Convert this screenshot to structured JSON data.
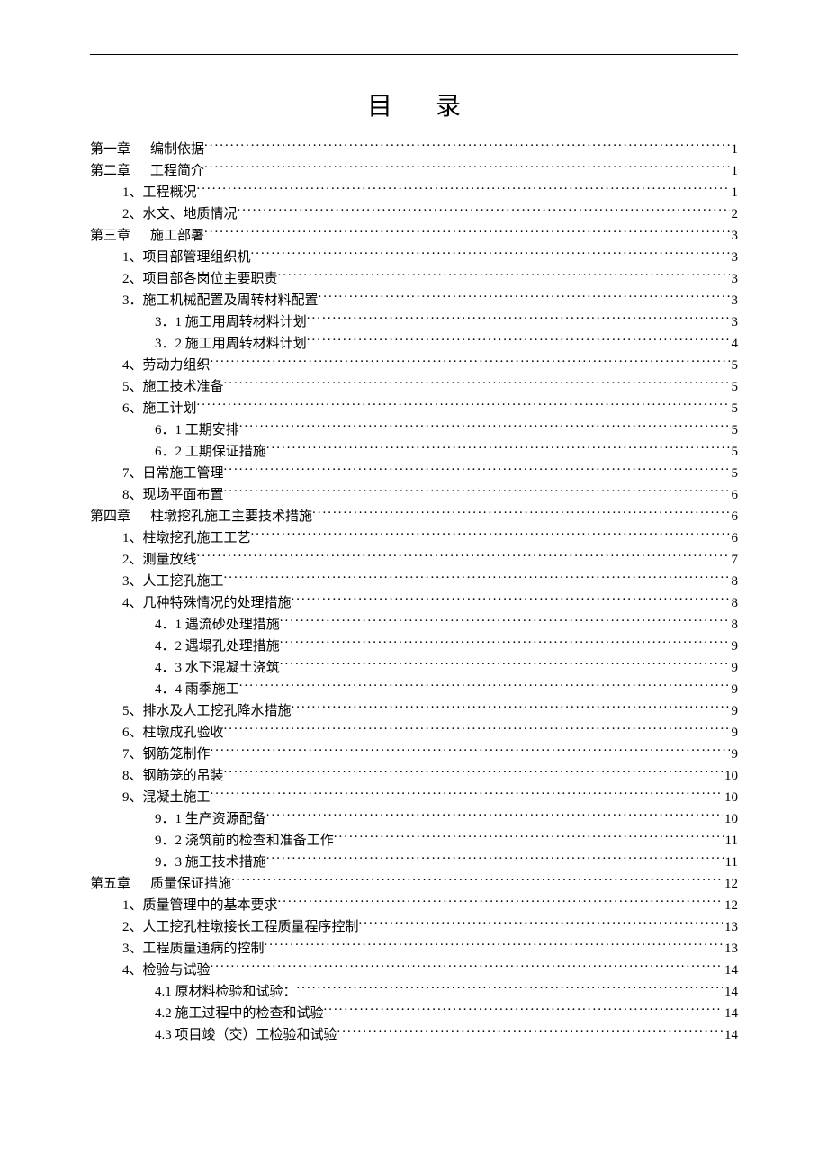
{
  "title": "目录",
  "toc": [
    {
      "indent": 0,
      "label_prefix": "第一章",
      "label_gap": true,
      "label": "编制依据",
      "page": "1"
    },
    {
      "indent": 0,
      "label_prefix": "第二章",
      "label_gap": true,
      "label": "工程简介",
      "page": "1"
    },
    {
      "indent": 1,
      "label_prefix": "",
      "label_gap": false,
      "label": "1、工程概况",
      "page": "1"
    },
    {
      "indent": 1,
      "label_prefix": "",
      "label_gap": false,
      "label": "2、水文、地质情况",
      "page": "2"
    },
    {
      "indent": 0,
      "label_prefix": "第三章",
      "label_gap": true,
      "label": "施工部署",
      "page": "3"
    },
    {
      "indent": 1,
      "label_prefix": "",
      "label_gap": false,
      "label": "1、项目部管理组织机",
      "page": "3"
    },
    {
      "indent": 1,
      "label_prefix": "",
      "label_gap": false,
      "label": "2、项目部各岗位主要职责",
      "page": "3"
    },
    {
      "indent": 1,
      "label_prefix": "",
      "label_gap": false,
      "label": "3．施工机械配置及周转材料配置",
      "page": "3"
    },
    {
      "indent": 2,
      "label_prefix": "",
      "label_gap": false,
      "label": "3．1 施工用周转材料计划",
      "page": "3"
    },
    {
      "indent": 2,
      "label_prefix": "",
      "label_gap": false,
      "label": "3．2 施工用周转材料计划",
      "page": "4"
    },
    {
      "indent": 1,
      "label_prefix": "",
      "label_gap": false,
      "label": "4、劳动力组织",
      "page": "5"
    },
    {
      "indent": 1,
      "label_prefix": "",
      "label_gap": false,
      "label": "5、施工技术准备",
      "page": "5"
    },
    {
      "indent": 1,
      "label_prefix": "",
      "label_gap": false,
      "label": "6、施工计划",
      "page": "5"
    },
    {
      "indent": 2,
      "label_prefix": "",
      "label_gap": false,
      "label": "6．1 工期安排",
      "page": "5"
    },
    {
      "indent": 2,
      "label_prefix": "",
      "label_gap": false,
      "label": "6．2 工期保证措施",
      "page": "5"
    },
    {
      "indent": 1,
      "label_prefix": "",
      "label_gap": false,
      "label": "7、日常施工管理",
      "page": "5"
    },
    {
      "indent": 1,
      "label_prefix": "",
      "label_gap": false,
      "label": "8、现场平面布置",
      "page": "6"
    },
    {
      "indent": 0,
      "label_prefix": "第四章",
      "label_gap": true,
      "label": "柱墩挖孔施工主要技术措施",
      "page": "6"
    },
    {
      "indent": 1,
      "label_prefix": "",
      "label_gap": false,
      "label": "1、柱墩挖孔施工工艺",
      "page": "6"
    },
    {
      "indent": 1,
      "label_prefix": "",
      "label_gap": false,
      "label": "2、测量放线",
      "page": "7"
    },
    {
      "indent": 1,
      "label_prefix": "",
      "label_gap": false,
      "label": "3、人工挖孔施工",
      "page": "8"
    },
    {
      "indent": 1,
      "label_prefix": "",
      "label_gap": false,
      "label": "4、几种特殊情况的处理措施",
      "page": "8"
    },
    {
      "indent": 2,
      "label_prefix": "",
      "label_gap": false,
      "label": "4．1 遇流砂处理措施",
      "page": "8"
    },
    {
      "indent": 2,
      "label_prefix": "",
      "label_gap": false,
      "label": "4．2 遇塌孔处理措施",
      "page": "9"
    },
    {
      "indent": 2,
      "label_prefix": "",
      "label_gap": false,
      "label": "4．3 水下混凝土浇筑",
      "page": "9"
    },
    {
      "indent": 2,
      "label_prefix": "",
      "label_gap": false,
      "label": "4．4 雨季施工",
      "page": "9"
    },
    {
      "indent": 1,
      "label_prefix": "",
      "label_gap": false,
      "label": "5、排水及人工挖孔降水措施",
      "page": "9"
    },
    {
      "indent": 1,
      "label_prefix": "",
      "label_gap": false,
      "label": "6、柱墩成孔验收",
      "page": "9"
    },
    {
      "indent": 1,
      "label_prefix": "",
      "label_gap": false,
      "label": "7、钢筋笼制作",
      "page": "9"
    },
    {
      "indent": 1,
      "label_prefix": "",
      "label_gap": false,
      "label": "8、钢筋笼的吊装",
      "page": "10"
    },
    {
      "indent": 1,
      "label_prefix": "",
      "label_gap": false,
      "label": "9、混凝土施工",
      "page": "10"
    },
    {
      "indent": 2,
      "label_prefix": "",
      "label_gap": false,
      "label": "9．1 生产资源配备",
      "page": "10"
    },
    {
      "indent": 2,
      "label_prefix": "",
      "label_gap": false,
      "label": "9．2 浇筑前的检查和准备工作",
      "page": "11"
    },
    {
      "indent": 2,
      "label_prefix": "",
      "label_gap": false,
      "label": "9．3 施工技术措施",
      "page": "11"
    },
    {
      "indent": 0,
      "label_prefix": "第五章",
      "label_gap": true,
      "label": "质量保证措施",
      "page": "12"
    },
    {
      "indent": 1,
      "label_prefix": "",
      "label_gap": false,
      "label": "1、质量管理中的基本要求",
      "page": "12"
    },
    {
      "indent": 1,
      "label_prefix": "",
      "label_gap": false,
      "label": "2、人工挖孔柱墩接长工程质量程序控制",
      "page": "13"
    },
    {
      "indent": 1,
      "label_prefix": "",
      "label_gap": false,
      "label": "3、工程质量通病的控制",
      "page": "13"
    },
    {
      "indent": 1,
      "label_prefix": "",
      "label_gap": false,
      "label": "4、检验与试验",
      "page": "14"
    },
    {
      "indent": 2,
      "label_prefix": "",
      "label_gap": false,
      "label": "4.1 原材料检验和试验：",
      "page": "14"
    },
    {
      "indent": 2,
      "label_prefix": "",
      "label_gap": false,
      "label": "4.2 施工过程中的检查和试验",
      "page": "14"
    },
    {
      "indent": 2,
      "label_prefix": "",
      "label_gap": false,
      "label": "4.3 项目竣（交）工检验和试验",
      "page": "14"
    }
  ]
}
